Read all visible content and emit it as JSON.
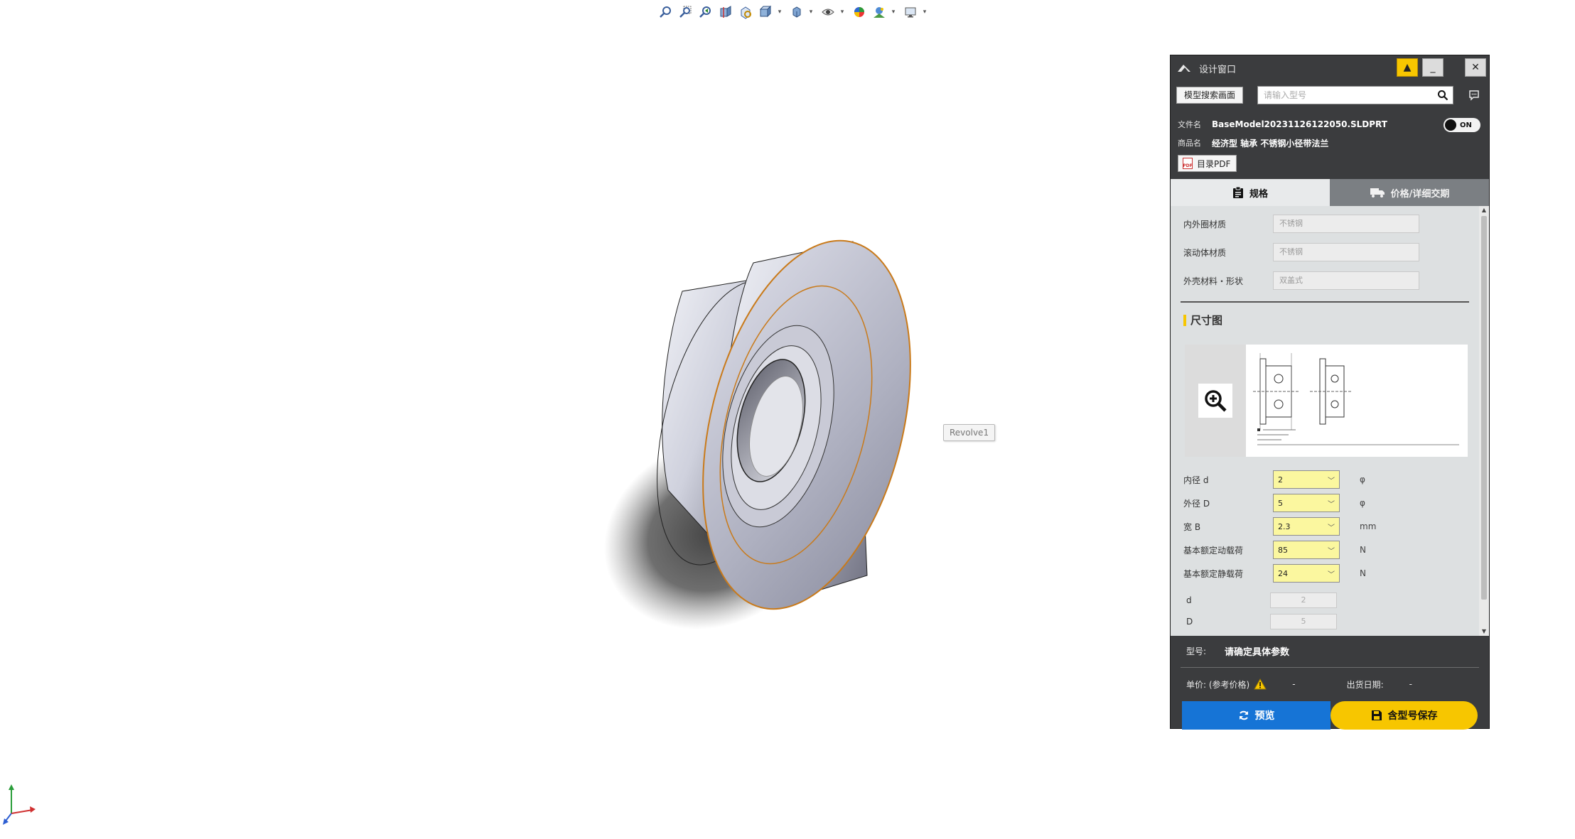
{
  "toolbar": {
    "icons": [
      "zoom-to-fit-icon",
      "zoom-area-icon",
      "previous-view-icon",
      "section-view-icon",
      "view-selector-icon",
      "view-orientation-icon",
      "display-style-icon",
      "hide-show-icon",
      "edit-appearance-icon",
      "apply-scene-icon",
      "view-settings-icon"
    ]
  },
  "viewport": {
    "feature_tooltip": "Revolve1"
  },
  "panel": {
    "title": "设计窗口",
    "pin_symbol": "▲",
    "minimize_symbol": "_",
    "close_symbol": "✕",
    "search_mode_label": "模型搜索画面",
    "search_placeholder": "请输入型号",
    "file_label": "文件名",
    "file_name": "BaseModel20231126122050.SLDPRT",
    "product_label": "商品名",
    "product_name": "经济型 轴承 不锈钢小径带法兰",
    "toggle_label": "ON",
    "pdf_label": "目录PDF",
    "pdf_icon_text": "PDF",
    "tabs": [
      {
        "label": "规格",
        "active": true
      },
      {
        "label": "价格/详细交期",
        "active": false
      }
    ],
    "specs": [
      {
        "label": "内外圈材质",
        "value": "不锈钢"
      },
      {
        "label": "滚动体材质",
        "value": "不锈钢"
      },
      {
        "label": "外壳材料・形状",
        "value": "双盖式"
      }
    ],
    "dimension_section_title": "尺寸图",
    "params": [
      {
        "label": "内径 d",
        "value": "2",
        "unit": "φ"
      },
      {
        "label": "外径 D",
        "value": "5",
        "unit": "φ"
      },
      {
        "label": "宽 B",
        "value": "2.3",
        "unit": "mm"
      },
      {
        "label": "基本额定动载荷",
        "value": "85",
        "unit": "N"
      },
      {
        "label": "基本额定静载荷",
        "value": "24",
        "unit": "N"
      }
    ],
    "readonly": [
      {
        "label": "d",
        "value": "2"
      },
      {
        "label": "D",
        "value": "5"
      }
    ],
    "model_label": "型号:",
    "model_value": "请确定具体参数",
    "price_label": "单价: (参考价格)",
    "price_value": "-",
    "ship_label": "出货日期:",
    "ship_value": "-",
    "preview_label": "预览",
    "save_label": "含型号保存",
    "colors": {
      "panel_bg": "#3b3c3e",
      "accent_yellow": "#f7c600",
      "preview_blue": "#1674d6",
      "param_field": "#fbf79f"
    }
  }
}
